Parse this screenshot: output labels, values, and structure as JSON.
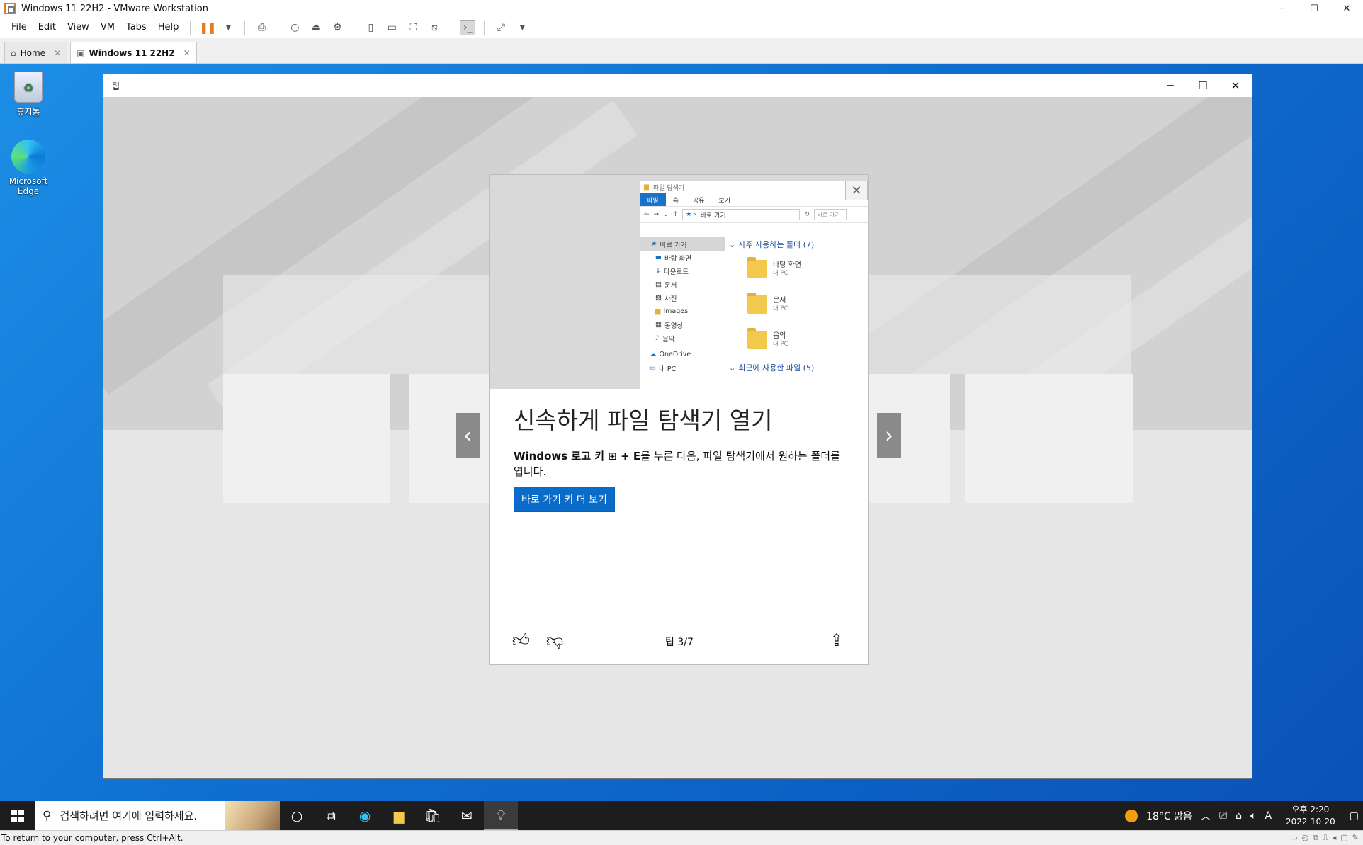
{
  "vmware": {
    "title": "Windows 11 22H2 - VMware Workstation",
    "window_controls": [
      "─",
      "☐",
      "✕"
    ],
    "menu": [
      "File",
      "Edit",
      "View",
      "VM",
      "Tabs",
      "Help"
    ],
    "tabs": [
      {
        "label": "Home",
        "active": false
      },
      {
        "label": "Windows 11 22H2",
        "active": true
      }
    ],
    "status_text": "To return to your computer, press Ctrl+Alt."
  },
  "desktop": {
    "icons": [
      {
        "label": "휴지통"
      },
      {
        "label": "Microsoft Edge"
      }
    ]
  },
  "tips_window": {
    "title": "팁",
    "card": {
      "heading": "신속하게 파일 탐색기 열기",
      "desc_prefix": "Windows",
      "desc_1": " 로고 키 ",
      "desc_key": "+ E",
      "desc_2": "를 누른 다음, 파일 탐색기에서 원하는 폴더를 엽니다.",
      "button": "바로 가기 키 더 보기",
      "counter": "팁 3/7"
    },
    "explorer": {
      "title": "파일 탐색기",
      "ribbon": [
        "파일",
        "홈",
        "공유",
        "보기"
      ],
      "address": "바로 가기",
      "search_placeholder": "바로 가기",
      "nav": [
        "바로 가기",
        "바탕 화면",
        "다운로드",
        "문서",
        "사진",
        "Images",
        "동영상",
        "음악",
        "OneDrive",
        "내 PC"
      ],
      "frequent_header": "자주 사용하는 폴더 (7)",
      "folders": [
        {
          "name": "바탕 화면",
          "sub": "내 PC"
        },
        {
          "name": "문서",
          "sub": "내 PC"
        },
        {
          "name": "음악",
          "sub": "내 PC"
        }
      ],
      "recent_header": "최근에 사용한 파일 (5)"
    }
  },
  "taskbar": {
    "search_placeholder": "검색하려면 여기에 입력하세요.",
    "weather": "18°C  맑음",
    "time": "오후 2:20",
    "date": "2022-10-20",
    "ime": "A"
  },
  "colors": {
    "accent": "#0a6cc8",
    "vm_accent": "#e87a1e",
    "desktop": "#1c8ee6",
    "taskbar": "#1d1d1d"
  }
}
